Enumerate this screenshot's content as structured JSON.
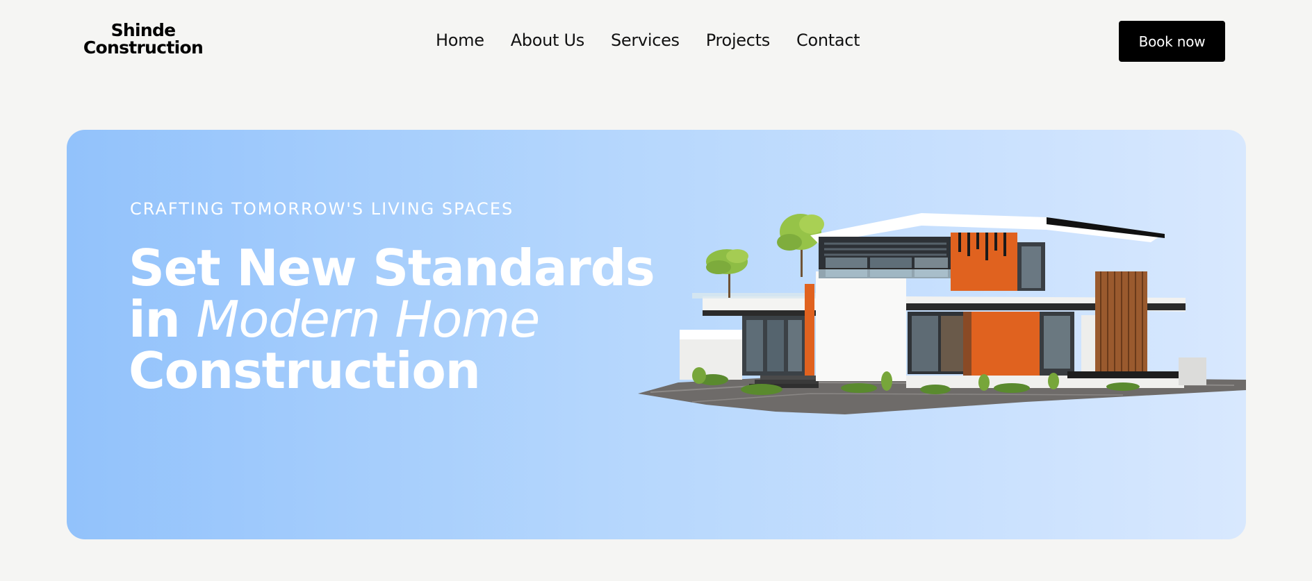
{
  "header": {
    "logo_line1": "Shinde",
    "logo_line2": "Construction",
    "nav": [
      "Home",
      "About Us",
      "Services",
      "Projects",
      "Contact"
    ],
    "cta": "Book now"
  },
  "hero": {
    "eyebrow": "CRAFTING TOMORROW'S LIVING SPACES",
    "headline_line1": "Set New Standards",
    "headline_line2_prefix": "in ",
    "headline_line2_emphasis": "Modern Home",
    "headline_line3": "Construction"
  },
  "colors": {
    "page_background": "#f5f5f3",
    "hero_gradient_start": "#92c2fb",
    "hero_gradient_end": "#d8e8fe",
    "button_background": "#000000",
    "accent_orange": "#e0621f"
  }
}
